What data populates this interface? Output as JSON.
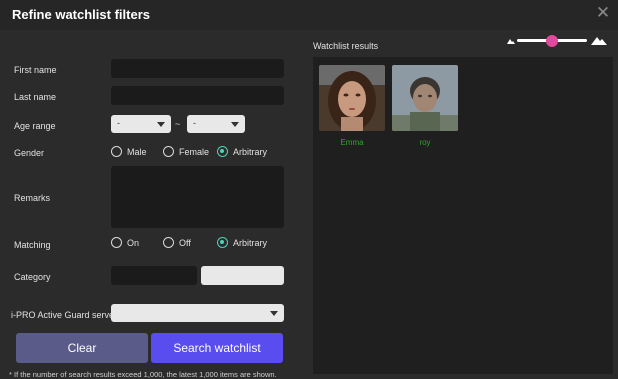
{
  "window": {
    "title": "Refine watchlist filters"
  },
  "form": {
    "first_name": {
      "label": "First name",
      "value": ""
    },
    "last_name": {
      "label": "Last name",
      "value": ""
    },
    "age_range": {
      "label": "Age range",
      "from": "-",
      "separator": "~",
      "to": "-"
    },
    "gender": {
      "label": "Gender",
      "options": [
        "Male",
        "Female",
        "Arbitrary"
      ],
      "selected": "Arbitrary"
    },
    "remarks": {
      "label": "Remarks",
      "value": ""
    },
    "matching": {
      "label": "Matching",
      "options": [
        "On",
        "Off",
        "Arbitrary"
      ],
      "selected": "Arbitrary"
    },
    "category": {
      "label": "Category",
      "value": ""
    },
    "server": {
      "label": "i-PRO Active Guard server",
      "value": ""
    }
  },
  "buttons": {
    "clear": "Clear",
    "search": "Search watchlist"
  },
  "note": "* If the number of search results exceed 1,000, the latest 1,000 items are shown.",
  "results": {
    "title": "Watchlist results",
    "zoom_level": 0.5,
    "items": [
      {
        "name": "Emma"
      },
      {
        "name": "roy"
      }
    ]
  },
  "colors": {
    "accent": "#5a4df0",
    "radio_selected": "#4fd1b5",
    "result_name": "#2fa52f",
    "slider_knob": "#e0499c"
  }
}
